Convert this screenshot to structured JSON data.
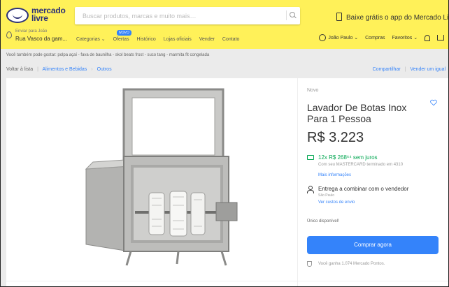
{
  "header": {
    "logo_text": "mercado livre",
    "search_placeholder": "Buscar produtos, marcas e muito mais…",
    "promo": "Baixe grátis o app do Mercado Livre",
    "location_label": "Enviar para João",
    "location_address": "Rua Vasco da gam...",
    "nav": [
      "Categorias ⌄",
      "Ofertas",
      "Histórico",
      "Lojas oficiais",
      "Vender",
      "Contato"
    ],
    "new_badge": "NOVO",
    "user": "João Paulo ⌄",
    "purchases": "Compras",
    "favorites": "Favoritos ⌄"
  },
  "also_searched": "Você também pode gostar: polpa açaí - fava de baunilha - skol beats frost - suco tang - marmita fit congelada",
  "breadcrumb": {
    "back": "Voltar à lista",
    "items": [
      "Alimentos e Bebidas",
      "Outros"
    ]
  },
  "share": {
    "share_label": "Compartilhar",
    "sell_label": "Vender um igual"
  },
  "product": {
    "condition": "Novo",
    "title": "Lavador De Botas Inox Para 1 Pessoa",
    "price": "R$ 3.223",
    "installments": "12x R$ 268⁶⁴ sem juros",
    "installments_detail": "Com seu MASTERCARD terminado em 4310",
    "more_info": "Mais informações",
    "shipping": "Entrega a combinar com o vendedor",
    "shipping_city": "São Paulo",
    "shipping_costs": "Ver custos de envio",
    "stock": "Único disponível!",
    "buy_button": "Comprar agora",
    "points": "Você ganha 1.074 Mercado Pontos."
  },
  "colors": {
    "header_bg": "#fff159",
    "accent": "#3483fa",
    "green": "#00a650"
  }
}
